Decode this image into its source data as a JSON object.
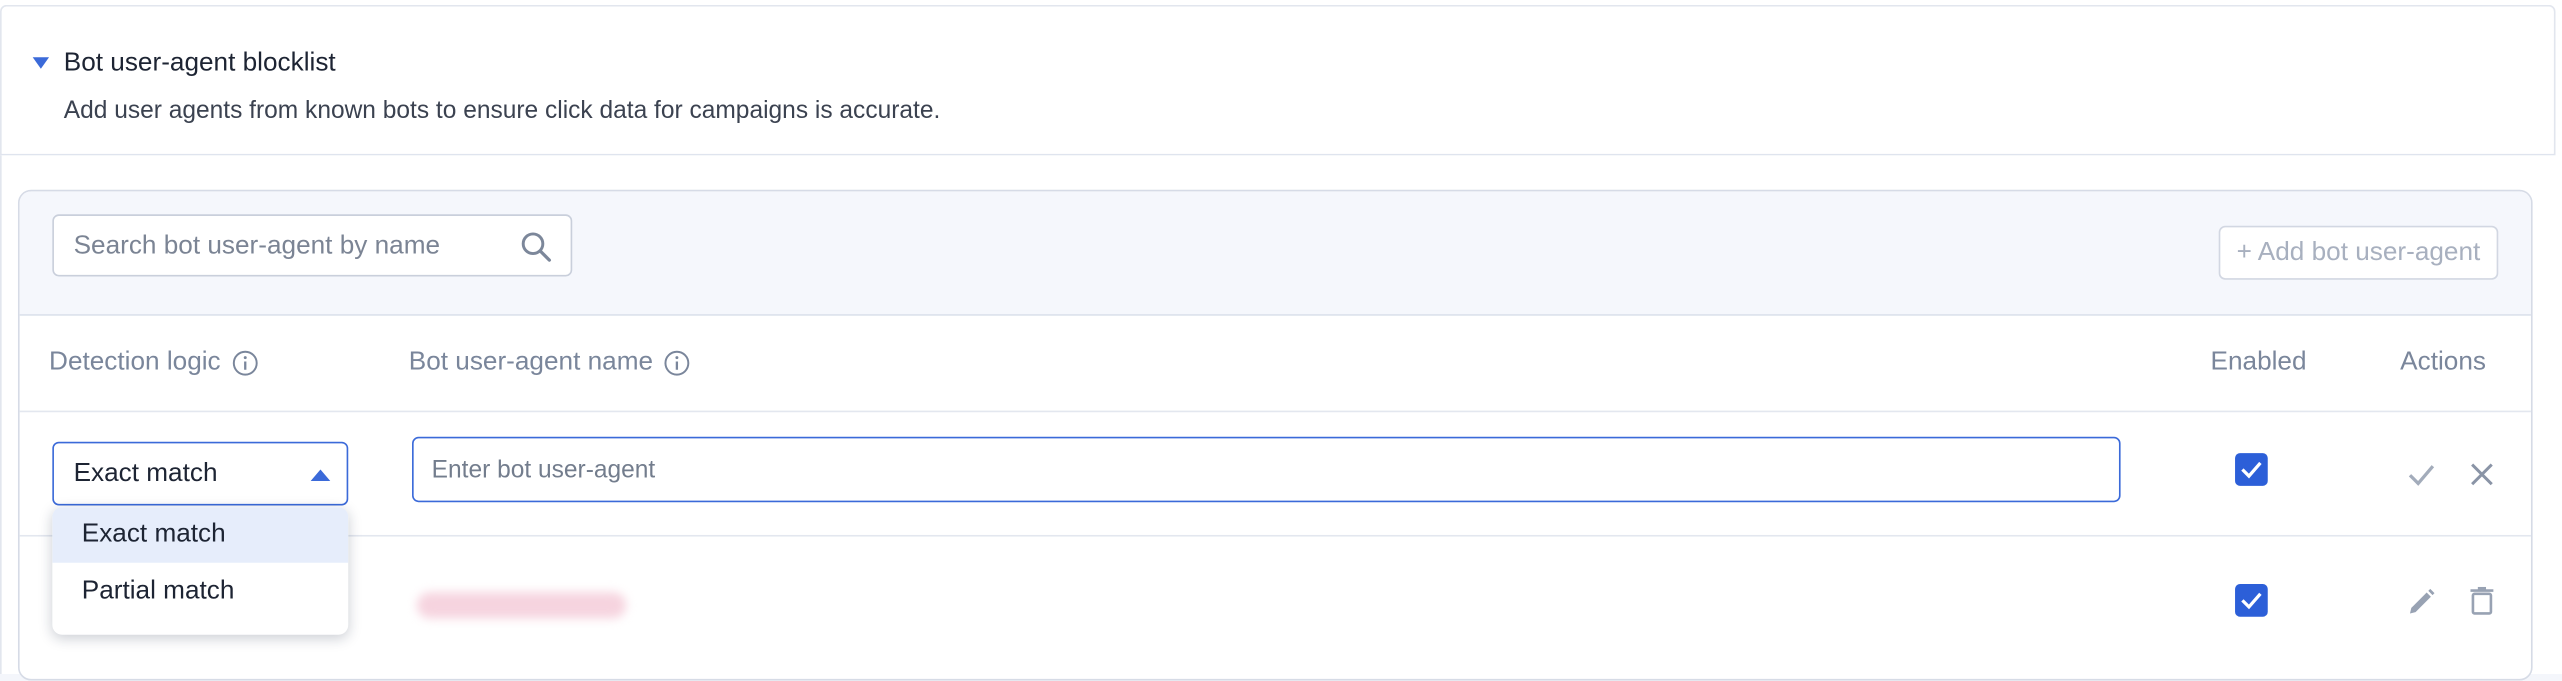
{
  "section": {
    "title": "Bot user-agent blocklist",
    "description": "Add user agents from known bots to ensure click data for campaigns is accurate."
  },
  "toolbar": {
    "search_placeholder": "Search bot user-agent by name",
    "add_button_label": "+ Add bot user-agent"
  },
  "table": {
    "columns": {
      "detection_logic": "Detection logic",
      "bot_name": "Bot user-agent name",
      "enabled": "Enabled",
      "actions": "Actions"
    },
    "edit_row": {
      "detection_logic_value": "Exact match",
      "name_placeholder": "Enter bot user-agent",
      "enabled": true
    },
    "rows": [
      {
        "name": "",
        "enabled": true
      }
    ]
  },
  "dropdown": {
    "options": [
      "Exact match",
      "Partial match"
    ],
    "selected": "Exact match"
  },
  "colors": {
    "accent": "#3b6ad9",
    "checkbox": "#2c5fd8",
    "header_text": "#7a869b"
  },
  "icons": {
    "section_toggle": "caret-down-icon",
    "search": "search-icon",
    "info": "info-icon",
    "confirm": "check-icon",
    "cancel": "close-icon",
    "edit": "pencil-icon",
    "delete": "trash-icon"
  }
}
